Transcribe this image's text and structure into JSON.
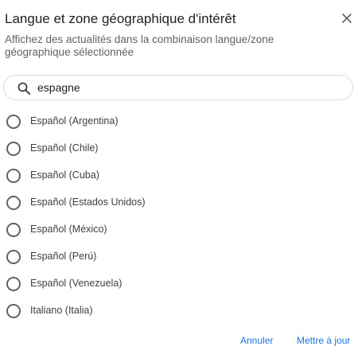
{
  "dialog": {
    "title": "Langue et zone géographique d'intérêt",
    "subtitle": "Affichez des actualités dans la combinaison langue/zone géographique sélectionnée",
    "search": {
      "value": "espagne",
      "icon": "search-icon"
    },
    "close_icon": "close-icon",
    "options": [
      {
        "label": "Español (Argentina)",
        "selected": false
      },
      {
        "label": "Español (Chile)",
        "selected": false
      },
      {
        "label": "Español (Cuba)",
        "selected": false
      },
      {
        "label": "Español (Estados Unidos)",
        "selected": false
      },
      {
        "label": "Español (México)",
        "selected": false
      },
      {
        "label": "Español (Perú)",
        "selected": false
      },
      {
        "label": "Español (Venezuela)",
        "selected": false
      },
      {
        "label": "Italiano (Italia)",
        "selected": false
      }
    ],
    "buttons": {
      "cancel": "Annuler",
      "update": "Mettre à jour"
    },
    "colors": {
      "accent": "#1a73e8",
      "text": "#202124",
      "secondary": "#5f6368"
    }
  }
}
